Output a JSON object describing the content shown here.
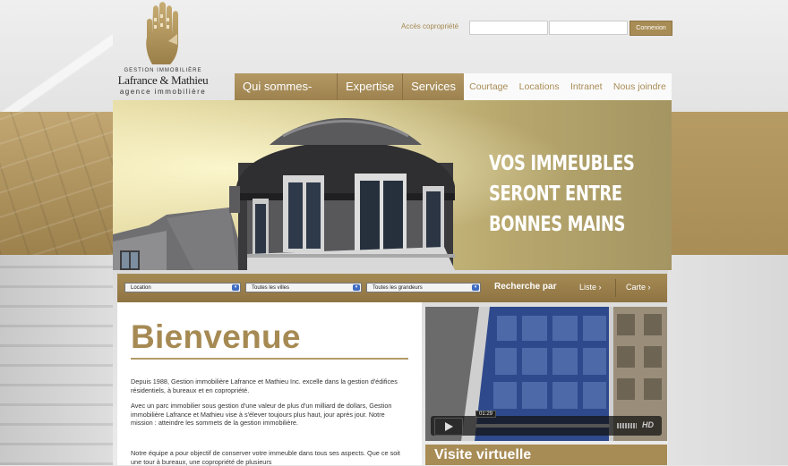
{
  "colors": {
    "accent": "#a88c55",
    "accent_dark": "#8f7443",
    "white": "#ffffff"
  },
  "logo": {
    "icon": "hand-logo-icon",
    "small_text": "GESTION IMMOBILIÈRE",
    "name": "Lafrance & Mathieu",
    "tagline": "agence immobilière"
  },
  "login": {
    "label": "Accès copropriété",
    "user_value": "",
    "password_value": "",
    "button": "Connexion"
  },
  "nav": {
    "main": [
      "Qui sommes-nous",
      "Expertise",
      "Services"
    ],
    "secondary": [
      "Courtage",
      "Locations",
      "Intranet",
      "Nous joindre"
    ]
  },
  "hero": {
    "line1": "VOS IMMEUBLES",
    "line2": "SERONT ENTRE",
    "line3": "BONNES MAINS"
  },
  "search": {
    "select_type": "Location",
    "select_city": "Toutes les villes",
    "select_size": "Toutes les grandeurs",
    "label": "Recherche par",
    "list": "Liste ›",
    "map": "Carte ›"
  },
  "content": {
    "title": "Bienvenue",
    "para1": "Depuis 1988, Gestion immobilière Lafrance et Mathieu Inc. excelle dans la gestion d'édifices résidentiels, à bureaux et en copropriété.",
    "para2": "Avec un parc immobilier sous gestion d'une valeur de plus d'un milliard de dollars, Gestion immobilière Lafrance et Mathieu vise à s'élever toujours plus haut, jour après jour. Notre mission : atteindre les sommets de la gestion immobilière.",
    "para3": "Notre équipe a pour objectif de conserver votre immeuble dans tous ses aspects. Que ce soit une tour à bureaux, une copropriété de plusieurs"
  },
  "video": {
    "timecode": "01:29",
    "progress": 0.0,
    "hd": "HD",
    "caption": "Visite virtuelle"
  }
}
